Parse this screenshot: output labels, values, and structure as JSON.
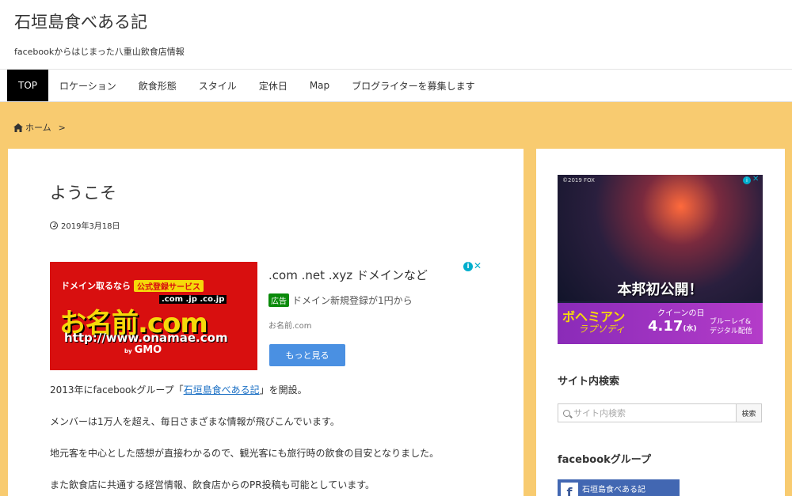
{
  "site": {
    "title": "石垣島食べある記",
    "description": "facebookからはじまった八重山飲食店情報"
  },
  "nav": {
    "items": [
      {
        "label": "TOP",
        "active": true
      },
      {
        "label": "ロケーション"
      },
      {
        "label": "飲食形態"
      },
      {
        "label": "スタイル"
      },
      {
        "label": "定休日"
      },
      {
        "label": "Map"
      },
      {
        "label": "ブログライターを募集します"
      }
    ]
  },
  "breadcrumb": {
    "home_label": "ホーム",
    "separator": ">"
  },
  "post": {
    "title": "ようこそ",
    "date": "2019年3月18日",
    "para1_before": "2013年にfacebookグループ「",
    "para1_link": "石垣島食べある記",
    "para1_after": "」を開設。",
    "para2": "メンバーは1万人を超え、毎日さまざまな情報が飛びこんでいます。",
    "para3": "地元客を中心とした感想が直接わかるので、観光客にも旅行時の飲食の目安となりました。",
    "para4": "また飲食店に共通する経営情報、飲食店からのPR投稿も可能としています。"
  },
  "ad": {
    "image_line1": "ドメイン取るなら",
    "image_badge": "公式登録サービス",
    "image_tlds": ".com .jp .co.jp",
    "image_logo": "お名前.com",
    "image_url": "http://www.onamae.com",
    "image_by": "by",
    "image_brand": "GMO",
    "headline": ".com .net .xyz ドメインなど",
    "label": "広告",
    "description": "ドメイン新規登録が1円から",
    "domain": "お名前.com",
    "button_label": "もっと見る",
    "info_icon": "i",
    "close_icon": "✕"
  },
  "sidebar": {
    "ad": {
      "copyright": "©2019 FOX",
      "headline": "本邦初公開！",
      "movie_title": "ボヘミアン",
      "movie_title2": "ラプソディ",
      "queen_day": "クイーンの日",
      "release_date": "4.17",
      "release_weekday": "(水)",
      "release_format1": "ブルーレイ&",
      "release_format2": "デジタル配信"
    },
    "search": {
      "title": "サイト内検索",
      "placeholder": "サイト内検索",
      "button_label": "検索"
    },
    "facebook": {
      "title": "facebookグループ",
      "card_label": "石垣島食べある記",
      "logo_letter": "f"
    }
  },
  "colors": {
    "accent_bg": "#f8cb70",
    "nav_active_bg": "#000000",
    "link": "#1a6fc4",
    "ad_button": "#4a90e2",
    "facebook_blue": "#4267b2"
  }
}
